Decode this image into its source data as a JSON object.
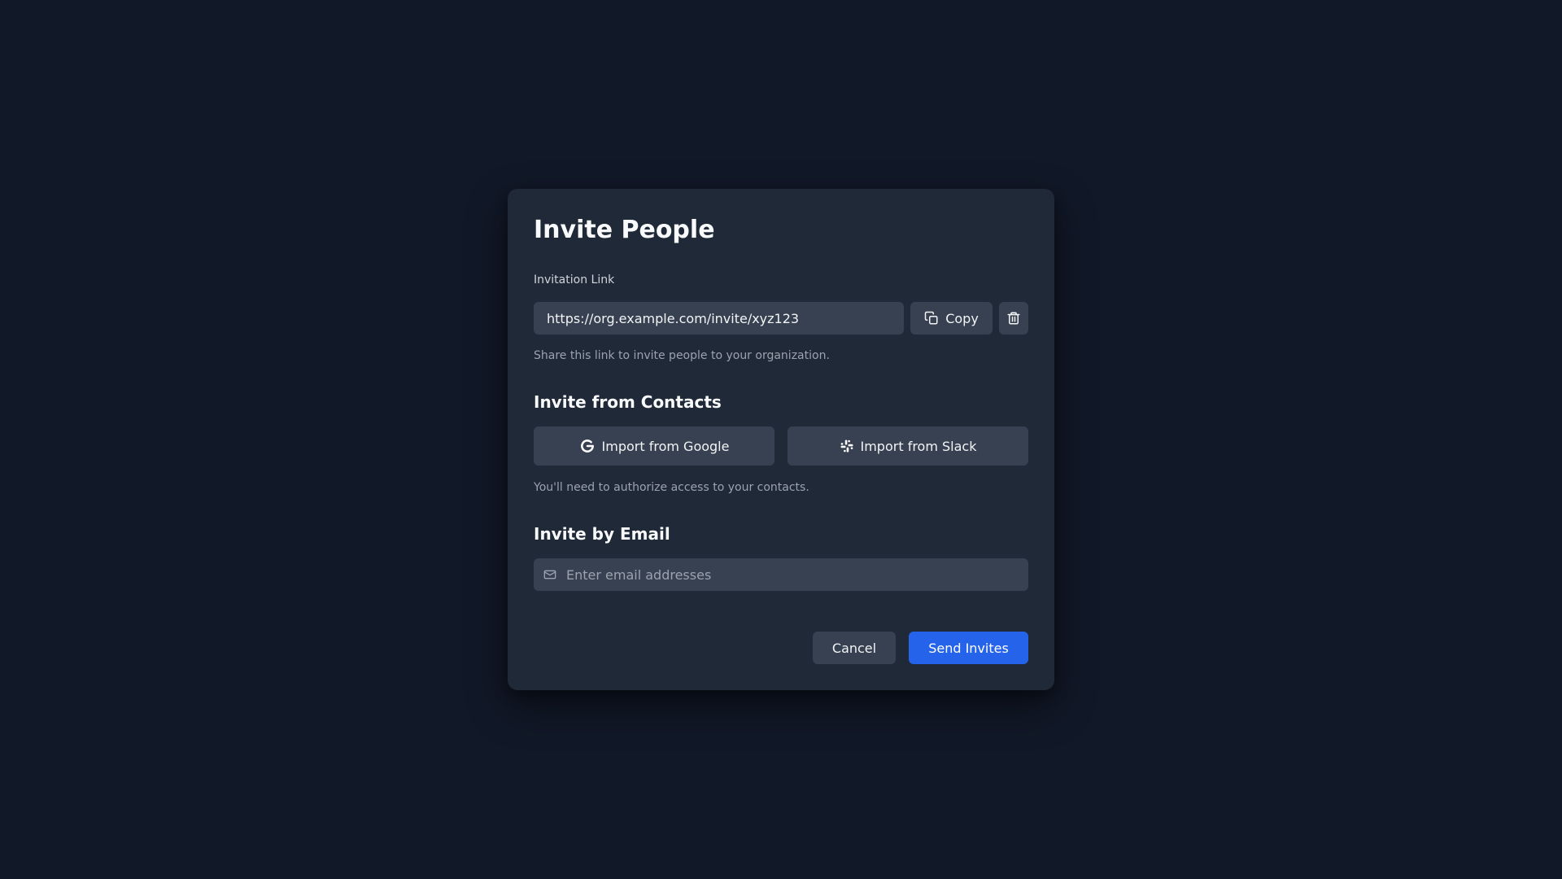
{
  "modal": {
    "title": "Invite People"
  },
  "invitation_link": {
    "label": "Invitation Link",
    "value": "https://org.example.com/invite/xyz123",
    "copy_label": "Copy",
    "copy_icon": "copy-icon",
    "delete_icon": "trash-icon",
    "hint": "Share this link to invite people to your organization."
  },
  "contacts": {
    "heading": "Invite from Contacts",
    "google_label": "Import from Google",
    "google_icon": "google-icon",
    "slack_label": "Import from Slack",
    "slack_icon": "slack-icon",
    "hint": "You'll need to authorize access to your contacts."
  },
  "email": {
    "heading": "Invite by Email",
    "placeholder": "Enter email addresses",
    "icon": "mail-icon"
  },
  "footer": {
    "cancel_label": "Cancel",
    "send_label": "Send Invites"
  },
  "colors": {
    "background": "#111827",
    "modal": "#1f2937",
    "input": "#374151",
    "primary": "#2563eb"
  }
}
